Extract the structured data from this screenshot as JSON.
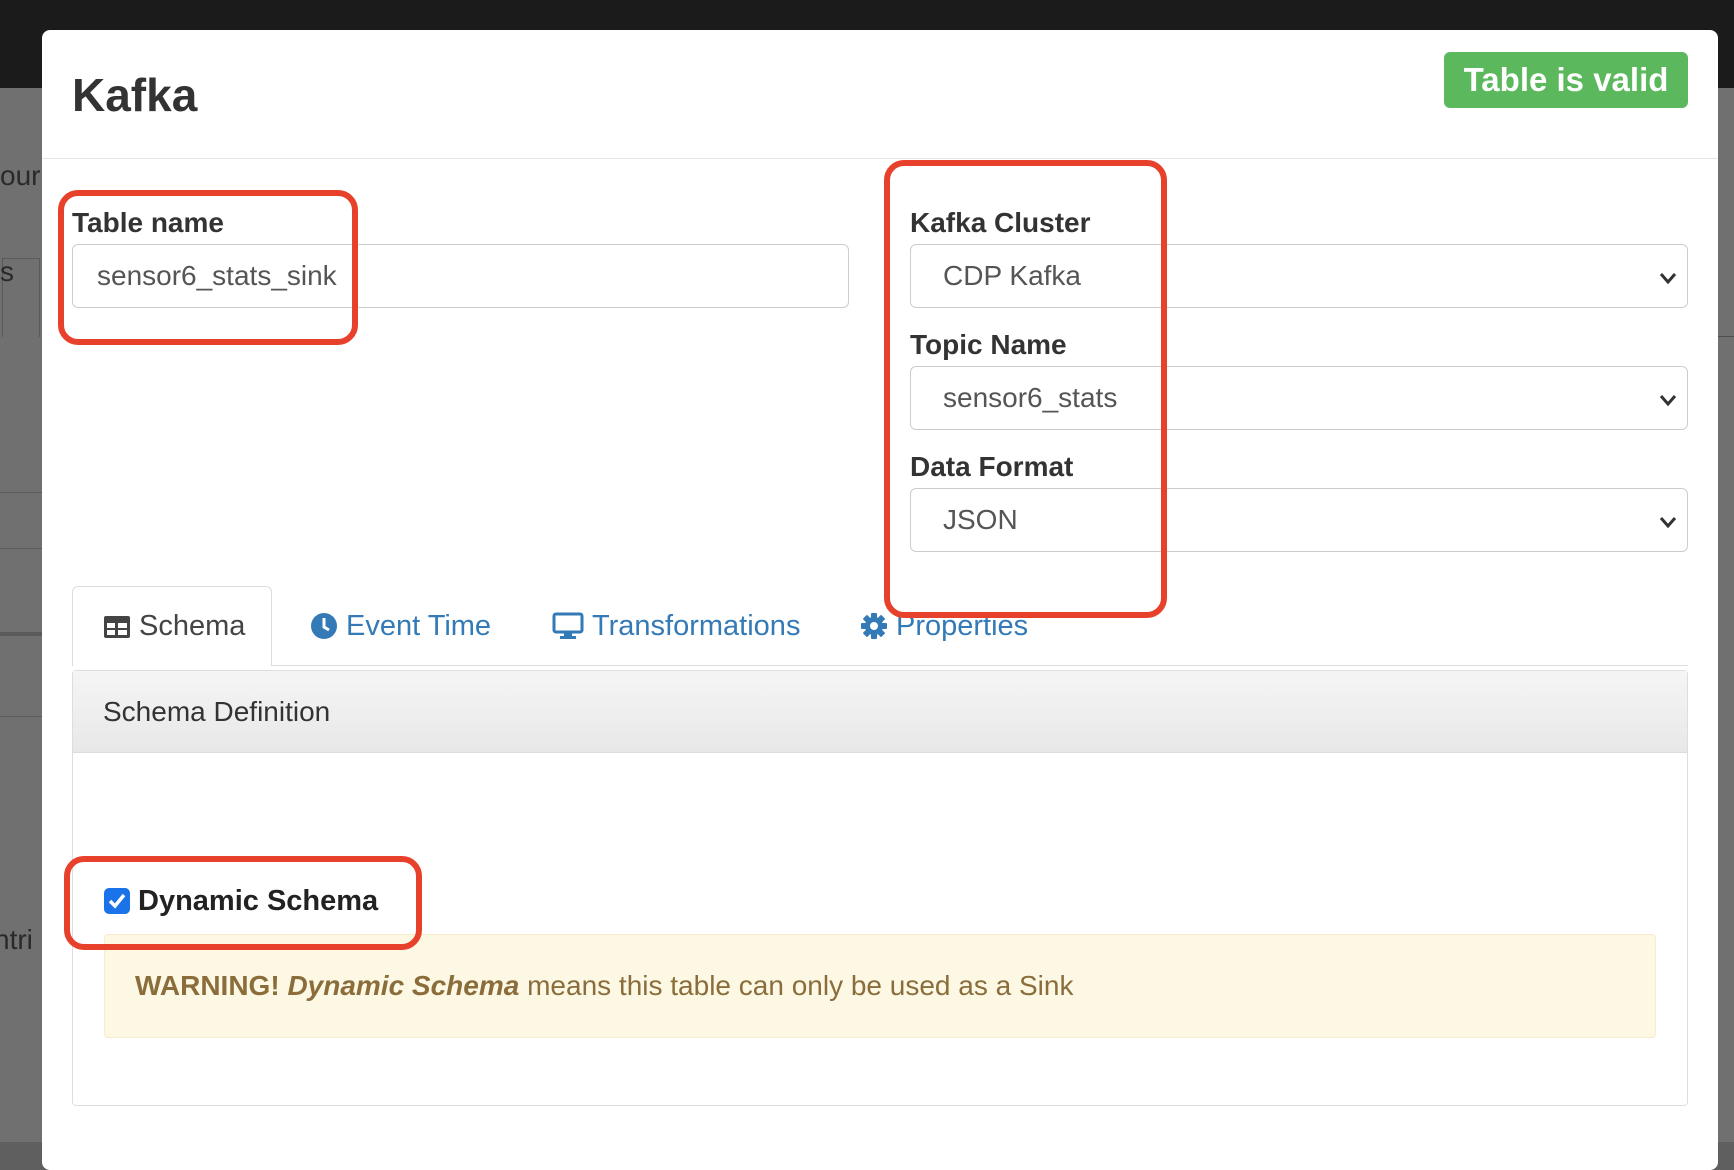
{
  "background": {
    "fragments": [
      "our",
      "s",
      "ntri"
    ]
  },
  "modal": {
    "title": "Kafka",
    "status_badge": "Table is valid"
  },
  "form": {
    "table_name": {
      "label": "Table name",
      "value": "sensor6_stats_sink"
    },
    "kafka_cluster": {
      "label": "Kafka Cluster",
      "value": "CDP Kafka"
    },
    "topic_name": {
      "label": "Topic Name",
      "value": "sensor6_stats"
    },
    "data_format": {
      "label": "Data Format",
      "value": "JSON"
    }
  },
  "tabs": [
    {
      "label": "Schema",
      "icon": "table-icon",
      "active": true
    },
    {
      "label": "Event Time",
      "icon": "clock-icon",
      "active": false
    },
    {
      "label": "Transformations",
      "icon": "monitor-icon",
      "active": false
    },
    {
      "label": "Properties",
      "icon": "gear-icon",
      "active": false
    }
  ],
  "schema_panel": {
    "heading": "Schema Definition",
    "dynamic_schema": {
      "label": "Dynamic Schema",
      "checked": true
    },
    "warning": {
      "prefix": "WARNING!",
      "emphasis": "Dynamic Schema",
      "text": "means this table can only be used as a Sink"
    }
  },
  "colors": {
    "badge_green": "#5cb85c",
    "highlight_red": "#e8412b",
    "link_blue": "#337ab7",
    "checkbox_blue": "#1a73e8",
    "warning_bg": "#fcf8e3",
    "warning_text": "#8a6d3b"
  }
}
